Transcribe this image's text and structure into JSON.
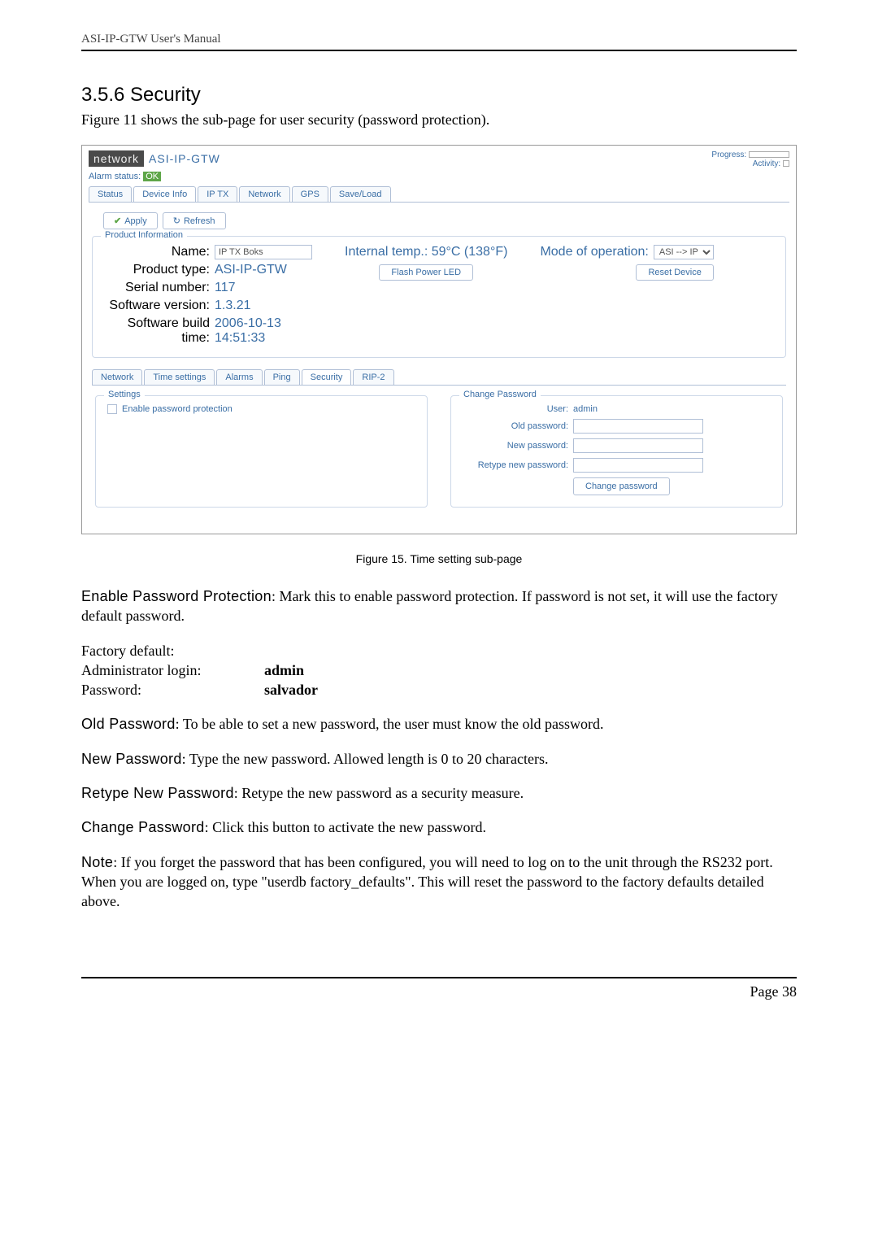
{
  "doc": {
    "header": "ASI-IP-GTW User's Manual",
    "section_num": "3.5.6 Security",
    "intro": "Figure 11 shows the sub-page for user security (password protection).",
    "fig_caption": "Figure 15. Time setting sub-page",
    "p_enable": "Enable Password Protection",
    "p_enable_rest": ": Mark this to enable password protection. If password is not set, it will use the factory default password.",
    "def_intro": "Factory default:",
    "def_login_lab": "Administrator login:",
    "def_login_val": "admin",
    "def_pw_lab": "Password:",
    "def_pw_val": "salvador",
    "p_old": "Old Password",
    "p_old_rest": ": To be able to set a new password, the user must know the old password.",
    "p_new": "New Password",
    "p_new_rest": ": Type the new password. Allowed length is 0 to 20 characters.",
    "p_retype": "Retype New Password",
    "p_retype_rest": ": Retype the new password as a security measure.",
    "p_change": "Change Password",
    "p_change_rest": ": Click this button to activate the new password.",
    "p_note": "Note",
    "p_note_rest": ": If you forget the password that has been configured, you will need to log on to the unit through the RS232 port. When you are logged on, type \"userdb factory_defaults\". This will reset the password to the factory defaults detailed above.",
    "footer": "Page 38"
  },
  "shot": {
    "logo": "network",
    "product": "ASI-IP-GTW",
    "progress_label": "Progress:",
    "activity_label": "Activity:",
    "alarm_label": "Alarm status:",
    "alarm_val": "OK",
    "tabs_top": [
      "Status",
      "Device Info",
      "IP TX",
      "Network",
      "GPS",
      "Save/Load"
    ],
    "apply": "Apply",
    "refresh": "Refresh",
    "fs_prodinfo": "Product Information",
    "name_lab": "Name:",
    "name_val": "IP TX Boks",
    "ptype_lab": "Product type:",
    "ptype_val": "ASI-IP-GTW",
    "serial_lab": "Serial number:",
    "serial_val": "117",
    "sw_lab": "Software version:",
    "sw_val": "1.3.21",
    "build_lab": "Software build time:",
    "build_val": "2006-10-13 14:51:33",
    "temp": "Internal temp.: 59°C (138°F)",
    "flash": "Flash Power LED",
    "mode_lab": "Mode of operation:",
    "mode_val": "ASI --> IP",
    "reset": "Reset Device",
    "tabs_sub": [
      "Network",
      "Time settings",
      "Alarms",
      "Ping",
      "Security",
      "RIP-2"
    ],
    "fs_settings": "Settings",
    "enable_pw": "Enable password protection",
    "fs_change": "Change Password",
    "user_lab": "User:",
    "user_val": "admin",
    "oldpw_lab": "Old password:",
    "newpw_lab": "New password:",
    "retypepw_lab": "Retype new password:",
    "changepw_btn": "Change password"
  }
}
